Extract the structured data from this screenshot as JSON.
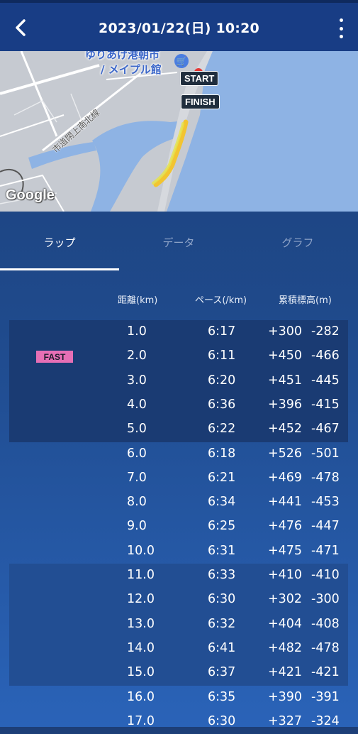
{
  "header": {
    "title": "2023/01/22(日) 10:20"
  },
  "map": {
    "place_label_line1": "ゆりあげ港朝市",
    "place_label_line2": "/ メイプル館",
    "road_label": "市道閖上南北線",
    "start_label": "START",
    "finish_label": "FINISH",
    "attribution": "Google"
  },
  "tabs": [
    {
      "label": "ラップ",
      "active": true
    },
    {
      "label": "データ",
      "active": false
    },
    {
      "label": "グラフ",
      "active": false
    }
  ],
  "table": {
    "headers": {
      "distance": "距離(km)",
      "pace": "ペース(/km)",
      "elevation": "累積標高(m)"
    },
    "fast_badge": "FAST",
    "rows": [
      {
        "km": "1.0",
        "pace": "6:17",
        "up": "+300",
        "down": "-282"
      },
      {
        "km": "2.0",
        "pace": "6:11",
        "up": "+450",
        "down": "-466"
      },
      {
        "km": "3.0",
        "pace": "6:20",
        "up": "+451",
        "down": "-445"
      },
      {
        "km": "4.0",
        "pace": "6:36",
        "up": "+396",
        "down": "-415"
      },
      {
        "km": "5.0",
        "pace": "6:22",
        "up": "+452",
        "down": "-467"
      },
      {
        "km": "6.0",
        "pace": "6:18",
        "up": "+526",
        "down": "-501"
      },
      {
        "km": "7.0",
        "pace": "6:21",
        "up": "+469",
        "down": "-478"
      },
      {
        "km": "8.0",
        "pace": "6:34",
        "up": "+441",
        "down": "-453"
      },
      {
        "km": "9.0",
        "pace": "6:25",
        "up": "+476",
        "down": "-447"
      },
      {
        "km": "10.0",
        "pace": "6:31",
        "up": "+475",
        "down": "-471"
      },
      {
        "km": "11.0",
        "pace": "6:33",
        "up": "+410",
        "down": "-410"
      },
      {
        "km": "12.0",
        "pace": "6:30",
        "up": "+302",
        "down": "-300"
      },
      {
        "km": "13.0",
        "pace": "6:32",
        "up": "+404",
        "down": "-408"
      },
      {
        "km": "14.0",
        "pace": "6:41",
        "up": "+482",
        "down": "-478"
      },
      {
        "km": "15.0",
        "pace": "6:37",
        "up": "+421",
        "down": "-421"
      },
      {
        "km": "16.0",
        "pace": "6:35",
        "up": "+390",
        "down": "-391"
      },
      {
        "km": "17.0",
        "pace": "6:30",
        "up": "+327",
        "down": "-324"
      }
    ]
  },
  "colors": {
    "topbar": "#183d85",
    "fast_badge": "#e66fb5",
    "route": "#f2c431"
  }
}
